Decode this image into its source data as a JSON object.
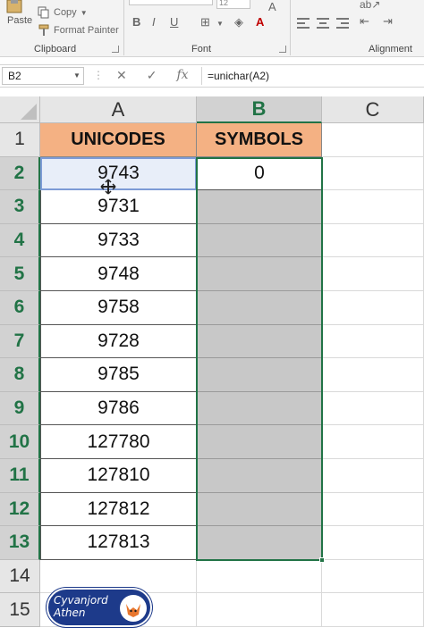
{
  "ribbon": {
    "paste_label": "Paste",
    "copy_label": "Copy",
    "format_painter_label": "Format Painter",
    "font_size_fragment": "12",
    "bold_label": "B",
    "italic_label": "I",
    "underline_label": "U",
    "groups": {
      "clipboard": "Clipboard",
      "font": "Font",
      "alignment": "Alignment"
    }
  },
  "formula_bar": {
    "name_box": "B2",
    "cancel_glyph": "✕",
    "enter_glyph": "✓",
    "fx_label": "fx",
    "formula": "=unichar(A2)"
  },
  "sheet": {
    "columns": [
      "A",
      "B",
      "C"
    ],
    "rows": [
      "1",
      "2",
      "3",
      "4",
      "5",
      "6",
      "7",
      "8",
      "9",
      "10",
      "11",
      "12",
      "13",
      "14",
      "15"
    ],
    "headers": {
      "a1": "UNICODES",
      "b1": "SYMBOLS"
    },
    "unicodes": [
      "9743",
      "9731",
      "9733",
      "9748",
      "9758",
      "9728",
      "9785",
      "9786",
      "127780",
      "127810",
      "127812",
      "127813"
    ],
    "b2_value": "0",
    "colors": {
      "header_fill": "#f4b183",
      "selection_green": "#217346",
      "range_fill": "#c8c8c8"
    }
  },
  "watermark": {
    "line1": "Cyvanjord",
    "line2": "Athen",
    "bg_color": "#1d3a8a"
  }
}
